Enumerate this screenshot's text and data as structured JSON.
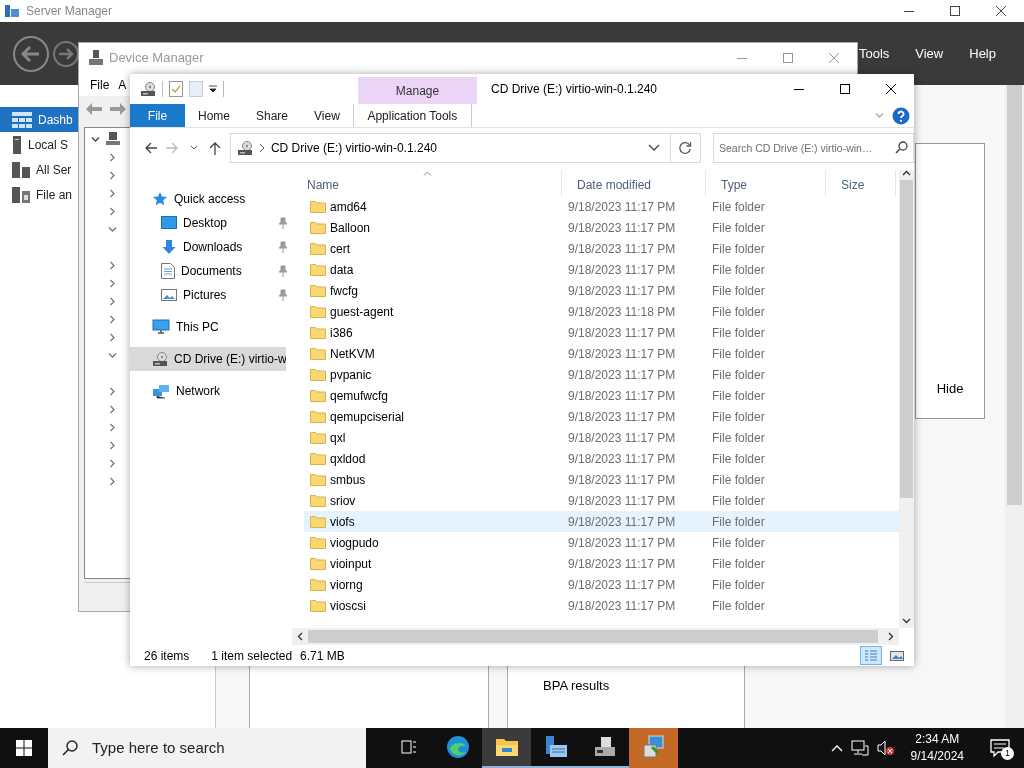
{
  "server_manager": {
    "title": "Server Manager",
    "menu": [
      "Tools",
      "View",
      "Help"
    ],
    "sidebar": [
      {
        "label": "Dashb",
        "kind": "dashboard",
        "selected": true
      },
      {
        "label": "Local S",
        "kind": "server",
        "selected": false
      },
      {
        "label": "All Ser",
        "kind": "servers",
        "selected": false
      },
      {
        "label": "File an",
        "kind": "files",
        "selected": false
      }
    ],
    "hide_label": "Hide",
    "tile_title": "BPA results"
  },
  "device_manager": {
    "title": "Device Manager",
    "menu": [
      "File",
      "A"
    ],
    "tree": {
      "expanded": true,
      "children": [
        {
          "expanded": false
        },
        {
          "expanded": false
        },
        {
          "expanded": false
        },
        {
          "expanded": false
        },
        {
          "expanded": true
        },
        {
          "expanded": false
        },
        {
          "expanded": false
        },
        {
          "expanded": false
        },
        {
          "expanded": false
        },
        {
          "expanded": false
        },
        {
          "expanded": true
        },
        {
          "expanded": false
        },
        {
          "expanded": false
        },
        {
          "expanded": false
        },
        {
          "expanded": false
        },
        {
          "expanded": false
        },
        {
          "expanded": false
        }
      ]
    }
  },
  "explorer": {
    "title": "CD Drive (E:) virtio-win-0.1.240",
    "context_group": "Manage",
    "ribbon_tabs": [
      {
        "label": "File",
        "kind": "file"
      },
      {
        "label": "Home",
        "kind": "tab"
      },
      {
        "label": "Share",
        "kind": "tab"
      },
      {
        "label": "View",
        "kind": "tab"
      },
      {
        "label": "Application Tools",
        "kind": "context"
      }
    ],
    "address": "CD Drive (E:) virtio-win-0.1.240",
    "search": {
      "placeholder": "Search CD Drive (E:) virtio-win…"
    },
    "nav": [
      {
        "label": "Quick access",
        "kind": "star",
        "selected": false,
        "children": [
          {
            "label": "Desktop",
            "kind": "desktop",
            "pinned": true,
            "selected": false
          },
          {
            "label": "Downloads",
            "kind": "download",
            "pinned": true,
            "selected": false
          },
          {
            "label": "Documents",
            "kind": "document",
            "pinned": true,
            "selected": false
          },
          {
            "label": "Pictures",
            "kind": "pictures",
            "pinned": true,
            "selected": false
          }
        ]
      },
      {
        "label": "This PC",
        "kind": "pc",
        "selected": false
      },
      {
        "label": "CD Drive (E:) virtio-w",
        "kind": "drive",
        "selected": true
      },
      {
        "label": "Network",
        "kind": "network",
        "selected": false
      }
    ],
    "columns": [
      {
        "label": "Name",
        "sorted": true
      },
      {
        "label": "Date modified",
        "sorted": false
      },
      {
        "label": "Type",
        "sorted": false
      },
      {
        "label": "Size",
        "sorted": false
      }
    ],
    "rows": [
      {
        "name": "amd64",
        "date": "9/18/2023 11:17 PM",
        "type": "File folder",
        "highlighted": false
      },
      {
        "name": "Balloon",
        "date": "9/18/2023 11:17 PM",
        "type": "File folder",
        "highlighted": false
      },
      {
        "name": "cert",
        "date": "9/18/2023 11:17 PM",
        "type": "File folder",
        "highlighted": false
      },
      {
        "name": "data",
        "date": "9/18/2023 11:17 PM",
        "type": "File folder",
        "highlighted": false
      },
      {
        "name": "fwcfg",
        "date": "9/18/2023 11:17 PM",
        "type": "File folder",
        "highlighted": false
      },
      {
        "name": "guest-agent",
        "date": "9/18/2023 11:18 PM",
        "type": "File folder",
        "highlighted": false
      },
      {
        "name": "i386",
        "date": "9/18/2023 11:17 PM",
        "type": "File folder",
        "highlighted": false
      },
      {
        "name": "NetKVM",
        "date": "9/18/2023 11:17 PM",
        "type": "File folder",
        "highlighted": false
      },
      {
        "name": "pvpanic",
        "date": "9/18/2023 11:17 PM",
        "type": "File folder",
        "highlighted": false
      },
      {
        "name": "qemufwcfg",
        "date": "9/18/2023 11:17 PM",
        "type": "File folder",
        "highlighted": false
      },
      {
        "name": "qemupciserial",
        "date": "9/18/2023 11:17 PM",
        "type": "File folder",
        "highlighted": false
      },
      {
        "name": "qxl",
        "date": "9/18/2023 11:17 PM",
        "type": "File folder",
        "highlighted": false
      },
      {
        "name": "qxldod",
        "date": "9/18/2023 11:17 PM",
        "type": "File folder",
        "highlighted": false
      },
      {
        "name": "smbus",
        "date": "9/18/2023 11:17 PM",
        "type": "File folder",
        "highlighted": false
      },
      {
        "name": "sriov",
        "date": "9/18/2023 11:17 PM",
        "type": "File folder",
        "highlighted": false
      },
      {
        "name": "viofs",
        "date": "9/18/2023 11:17 PM",
        "type": "File folder",
        "highlighted": true
      },
      {
        "name": "viogpudo",
        "date": "9/18/2023 11:17 PM",
        "type": "File folder",
        "highlighted": false
      },
      {
        "name": "vioinput",
        "date": "9/18/2023 11:17 PM",
        "type": "File folder",
        "highlighted": false
      },
      {
        "name": "viorng",
        "date": "9/18/2023 11:17 PM",
        "type": "File folder",
        "highlighted": false
      },
      {
        "name": "vioscsi",
        "date": "9/18/2023 11:17 PM",
        "type": "File folder",
        "highlighted": false
      }
    ],
    "status": {
      "count": "26 items",
      "selection": "1 item selected",
      "size": "6.71 MB"
    },
    "views": [
      {
        "kind": "details",
        "selected": true
      },
      {
        "kind": "tiles",
        "selected": false
      }
    ]
  },
  "taskbar": {
    "search_placeholder": "Type here to search",
    "apps": [
      {
        "kind": "taskview",
        "selected": false,
        "running": false,
        "attention": false
      },
      {
        "kind": "browser",
        "selected": false,
        "running": false,
        "attention": false
      },
      {
        "kind": "explorer",
        "selected": true,
        "running": true,
        "attention": false
      },
      {
        "kind": "server",
        "selected": false,
        "running": true,
        "attention": false
      },
      {
        "kind": "device",
        "selected": false,
        "running": true,
        "attention": false
      },
      {
        "kind": "installer",
        "selected": false,
        "running": false,
        "attention": true
      }
    ],
    "time": "2:34 AM",
    "date": "9/14/2024",
    "notifications": "1"
  }
}
